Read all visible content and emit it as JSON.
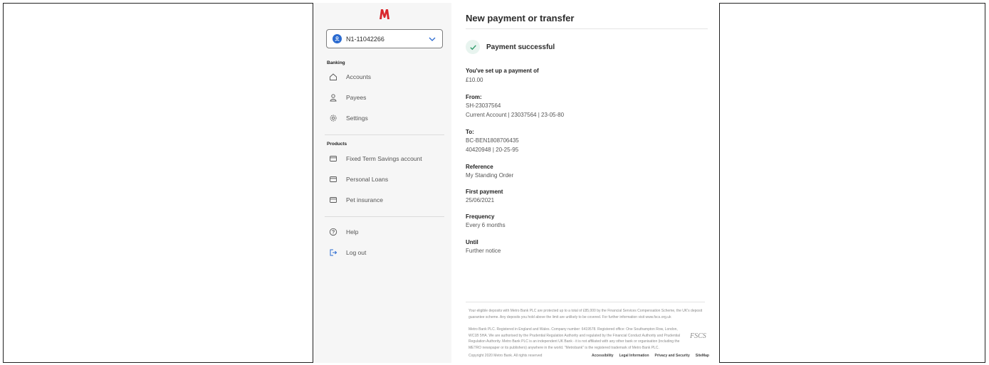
{
  "sidebar": {
    "account_number": "N1-11042266",
    "banking_label": "Banking",
    "banking_items": [
      {
        "label": "Accounts",
        "icon": "home-icon"
      },
      {
        "label": "Payees",
        "icon": "user-icon"
      },
      {
        "label": "Settings",
        "icon": "gear-icon"
      }
    ],
    "products_label": "Products",
    "product_items": [
      {
        "label": "Fixed Term Savings account",
        "icon": "card-icon"
      },
      {
        "label": "Personal Loans",
        "icon": "card-icon"
      },
      {
        "label": "Pet insurance",
        "icon": "card-icon"
      }
    ],
    "help_label": "Help",
    "logout_label": "Log out"
  },
  "main": {
    "title": "New payment or transfer",
    "success_text": "Payment successful",
    "fields": {
      "setup_label": "You've set up a payment of",
      "amount": "£10.00",
      "from_label": "From:",
      "from_name": "SH-23037564",
      "from_detail": "Current Account  |  23037564  |  23-05-80",
      "to_label": "To:",
      "to_name": "BC-BEN1808706435",
      "to_detail": "40420948  |  20-25-95",
      "reference_label": "Reference",
      "reference_value": "My Standing Order",
      "first_payment_label": "First payment",
      "first_payment_value": "25/06/2021",
      "frequency_label": "Frequency",
      "frequency_value": "Every 6 months",
      "until_label": "Until",
      "until_value": "Further notice"
    }
  },
  "footer": {
    "legal1": "Your eligible deposits with Metro Bank PLC are protected up to a total of £85,000 by the Financial Services Compensation Scheme, the UK's deposit guarantee scheme. Any deposits you hold above the limit are unlikely to be covered. For further information visit www.fscs.org.uk",
    "legal2": "Metro Bank PLC. Registered in England and Wales. Company number: 6419578. Registered office: One Southampton Row, London, WC1B 5HA. We are authorised by the Prudential Regulation Authority and regulated by the Financial Conduct Authority and Prudential Regulation Authority. Metro Bank PLC is an independent UK Bank - it is not affiliated with any other bank or organisation (including the METRO newspaper or its publishers) anywhere in the world. \"Metrobank\" is the registered trademark of Metro Bank PLC.",
    "copyright": "Copyright 2020 Metro Bank. All rights reserved",
    "links": [
      "Accessibility",
      "Legal Information",
      "Privacy and Security",
      "SiteMap"
    ],
    "fscs_logo": "FSCS"
  },
  "colors": {
    "brand_red": "#d9262c",
    "accent_blue": "#2a6ad0",
    "success_green": "#2e9a6b"
  }
}
